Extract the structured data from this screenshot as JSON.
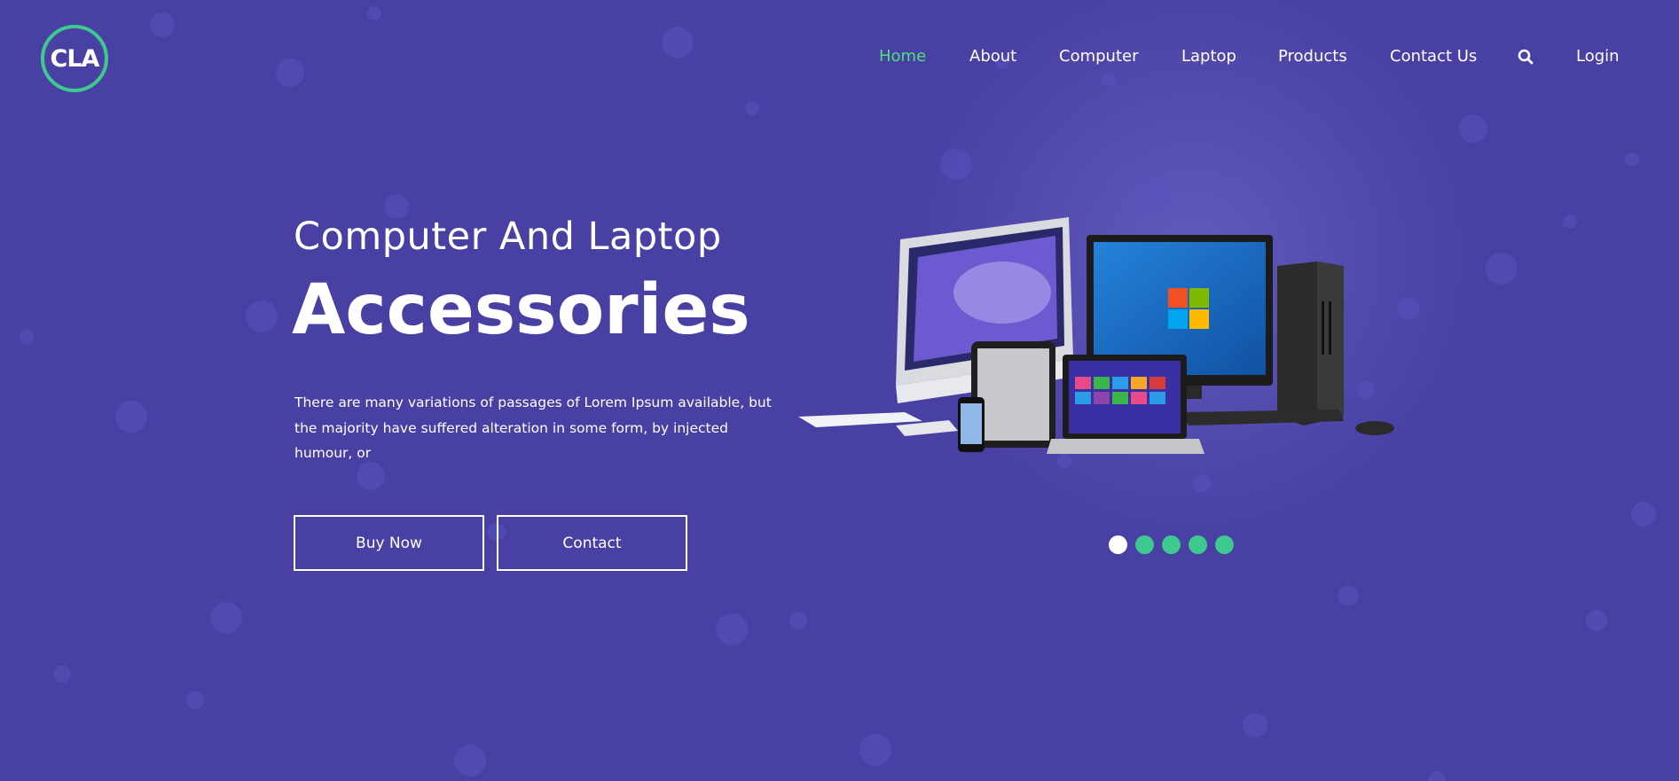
{
  "logo": {
    "text": "CLA"
  },
  "nav": {
    "items": [
      "Home",
      "About",
      "Computer",
      "Laptop",
      "Products",
      "Contact Us"
    ],
    "active_index": 0,
    "search_icon": "search-icon",
    "login_label": "Login"
  },
  "hero": {
    "subtitle": "Computer And Laptop",
    "title": "Accessories",
    "description": "There are many variations of passages of Lorem Ipsum available, but the majority have suffered alteration in some form, by injected humour, or",
    "buy_label": "Buy Now",
    "contact_label": "Contact"
  },
  "carousel": {
    "slide_count": 5,
    "active_index": 0
  },
  "colors": {
    "background": "#4840a3",
    "accent_green": "#3ec98f",
    "active_nav": "#4ee07a"
  }
}
